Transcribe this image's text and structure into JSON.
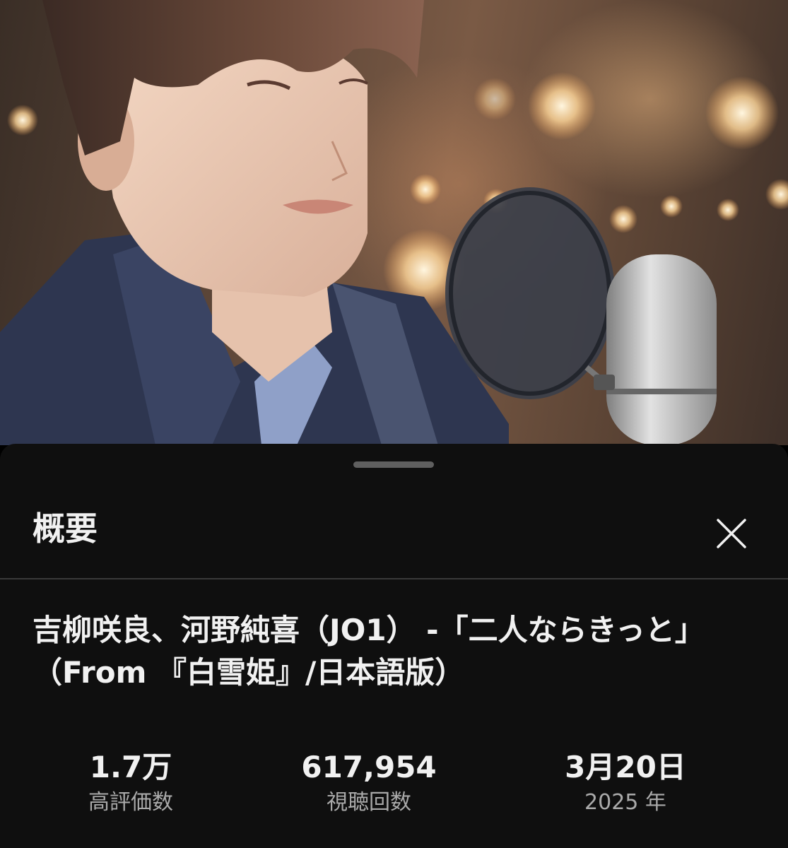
{
  "sheet": {
    "title": "概要",
    "close_icon": "close-icon",
    "video_title": "吉柳咲良、河野純喜（JO1） -「二人ならきっと」（From 『白雪姫』/日本語版）"
  },
  "stats": [
    {
      "value": "1.7万",
      "label": "高評価数"
    },
    {
      "value": "617,954",
      "label": "視聴回数"
    },
    {
      "value": "3月20日",
      "label": "2025 年"
    }
  ],
  "colors": {
    "sheet_background": "#0f0f0f",
    "primary_text": "#f1f1f1",
    "secondary_text": "#aaaaaa",
    "divider": "#3a3a3a"
  }
}
